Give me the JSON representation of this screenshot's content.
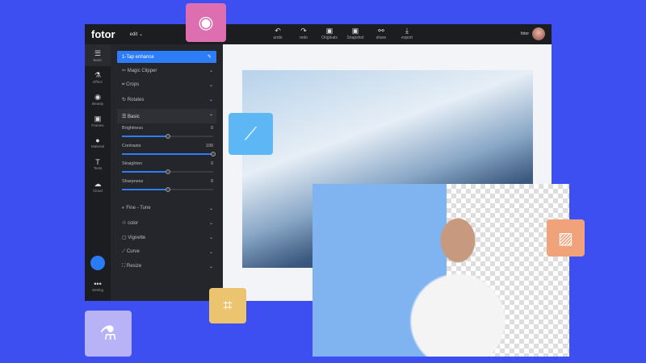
{
  "app": {
    "logo": "fotor",
    "menu": "edit"
  },
  "toolbar": [
    {
      "icon": "undo-icon",
      "glyph": "↶",
      "label": "undo"
    },
    {
      "icon": "redo-icon",
      "glyph": "↷",
      "label": "redo"
    },
    {
      "icon": "originals-icon",
      "glyph": "▣",
      "label": "Originals"
    },
    {
      "icon": "snapshot-icon",
      "glyph": "▣",
      "label": "Snapshot"
    },
    {
      "icon": "share-icon",
      "glyph": "⚯",
      "label": "share"
    },
    {
      "icon": "export-icon",
      "glyph": "⤓",
      "label": "export"
    }
  ],
  "user": {
    "name": "fotor"
  },
  "rail": [
    {
      "icon": "sliders-icon",
      "glyph": "☰",
      "label": "Basic"
    },
    {
      "icon": "flask-icon",
      "glyph": "⚗",
      "label": "Effect"
    },
    {
      "icon": "eye-icon",
      "glyph": "◉",
      "label": "Beauty"
    },
    {
      "icon": "frame-icon",
      "glyph": "▣",
      "label": "Frames"
    },
    {
      "icon": "material-icon",
      "glyph": "●",
      "label": "Material"
    },
    {
      "icon": "text-icon",
      "glyph": "T",
      "label": "Texts"
    },
    {
      "icon": "cloud-icon",
      "glyph": "☁",
      "label": "Cloud"
    }
  ],
  "setting": {
    "label": "Setting"
  },
  "panel": {
    "enhance": "1-Tap enhance",
    "top_items": [
      {
        "icon": "scissors-icon",
        "glyph": "✂",
        "label": "Magic Clipper"
      },
      {
        "icon": "crop-icon",
        "glyph": "⌗",
        "label": "Crops"
      },
      {
        "icon": "rotate-icon",
        "glyph": "↻",
        "label": "Rotates"
      }
    ],
    "basic": "Basic",
    "sliders": [
      {
        "label": "Brightness",
        "value": 0,
        "fraction": 0.5
      },
      {
        "label": "Contrasts",
        "value": 100,
        "fraction": 1
      },
      {
        "label": "Straighten",
        "value": 0,
        "fraction": 0.5
      },
      {
        "label": "Sharpness",
        "value": 0,
        "fraction": 0.5
      }
    ],
    "bottom_items": [
      {
        "icon": "droplet-icon",
        "glyph": "◐",
        "label": "Fine - Tune"
      },
      {
        "icon": "color-icon",
        "glyph": "♲",
        "label": "color"
      },
      {
        "icon": "vignette-icon",
        "glyph": "▢",
        "label": "Vignette"
      },
      {
        "icon": "curve-icon",
        "glyph": "⟋",
        "label": "Curve"
      },
      {
        "icon": "resize-icon",
        "glyph": "⛶",
        "label": "Resize"
      }
    ]
  },
  "colors": {
    "background": "#3d4ff0",
    "accent": "#2c7df7"
  }
}
